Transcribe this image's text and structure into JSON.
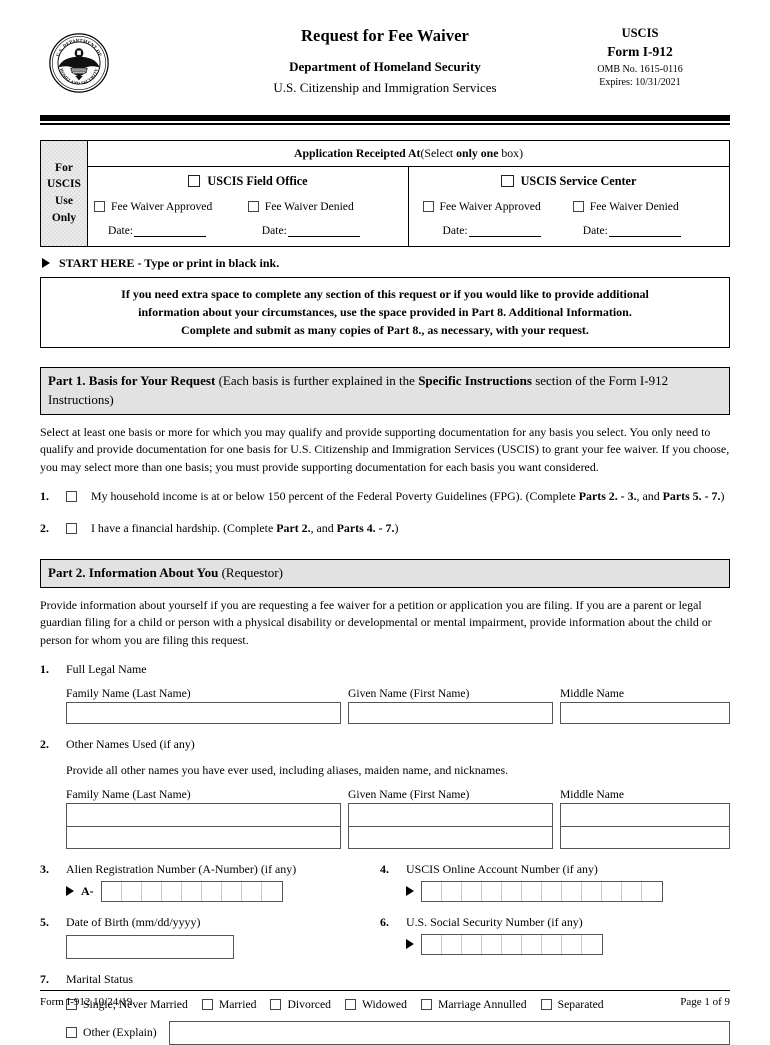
{
  "header": {
    "seal_icon": "dhs-seal-icon",
    "seal_text_top": "U.S. DEPARTMENT OF",
    "seal_text_bottom": "HOMELAND SECURITY",
    "title": "Request for Fee Waiver",
    "agency": "Department of Homeland Security",
    "subagency": "U.S. Citizenship and Immigration Services",
    "uscis": "USCIS",
    "form_number": "Form I-912",
    "omb": "OMB No. 1615-0116",
    "expires": "Expires: 10/31/2021"
  },
  "uscis_use": {
    "side_label_lines": [
      "For",
      "USCIS",
      "Use",
      "Only"
    ],
    "receipt_head_plain_1": "Application Receipted At",
    "receipt_head_paren_open": "(Select ",
    "receipt_head_bold": "only one",
    "receipt_head_paren_close": " box)",
    "columns": [
      {
        "office": "USCIS Field Office",
        "approved": "Fee Waiver Approved",
        "denied": "Fee Waiver Denied",
        "date_label_1": "Date:",
        "date_label_2": "Date:"
      },
      {
        "office": "USCIS Service Center",
        "approved": "Fee Waiver Approved",
        "denied": "Fee Waiver Denied",
        "date_label_1": "Date:",
        "date_label_2": "Date:"
      }
    ]
  },
  "start_here": {
    "arrow_icon": "right-triangle-icon",
    "text": "START HERE - Type or print in black ink."
  },
  "notice": {
    "line1": "If you need extra space to complete any section of this request or if you would like to provide additional",
    "line2": "information about your circumstances, use the space provided in Part 8. Additional Information.",
    "line3": "Complete and submit as many copies of Part 8., as necessary, with your request."
  },
  "part1": {
    "heading_bold_1": "Part 1.  Basis for Your Request",
    "heading_plain_1": " (Each basis is further explained in the ",
    "heading_bold_2": "Specific Instructions",
    "heading_plain_2": " section of the Form I-912 Instructions)",
    "intro": "Select at least one basis or more for which you may qualify and provide supporting documentation for any basis you select.  You only need to qualify and provide documentation for one basis for U.S. Citizenship and Immigration Services (USCIS) to grant your fee waiver.  If you choose, you may select more than one basis; you must provide supporting documentation for each basis you want considered.",
    "items": [
      {
        "number": "1.",
        "text_a": "My household income is at or below 150 percent of the Federal Poverty Guidelines (FPG).  (Complete ",
        "bold_a": "Parts 2. - 3.",
        "text_b": ", and ",
        "bold_b": "Parts 5. - 7.",
        "text_c": ")"
      },
      {
        "number": "2.",
        "text_a": "I have a financial hardship.  (Complete ",
        "bold_a": "Part 2.",
        "text_b": ", and ",
        "bold_b": "Parts 4. - 7.",
        "text_c": ")"
      }
    ]
  },
  "part2": {
    "heading_bold": "Part 2.  Information About You",
    "heading_plain": " (Requestor)",
    "intro": "Provide information about yourself if you are requesting a fee waiver for a petition or application you are filing.  If you are a parent or legal guardian filing for a child or person with a physical disability or developmental or mental impairment, provide information about the child or person for whom you are filing this request.",
    "q1": {
      "number": "1.",
      "label": "Full Legal Name",
      "family_label": "Family Name (Last Name)",
      "given_label": "Given Name (First Name)",
      "middle_label": "Middle Name",
      "family_value": "",
      "given_value": "",
      "middle_value": ""
    },
    "q2": {
      "number": "2.",
      "label": "Other Names Used (if any)",
      "note": "Provide all other names you have ever used, including aliases, maiden name, and nicknames.",
      "family_label": "Family Name (Last Name)",
      "given_label": "Given Name (First Name)",
      "middle_label": "Middle Name"
    },
    "q3": {
      "number": "3.",
      "label": "Alien Registration Number (A-Number) (if any)",
      "prefix": "A-",
      "cells": 9,
      "arrow_icon": "right-triangle-icon"
    },
    "q4": {
      "number": "4.",
      "label": "USCIS Online Account Number (if any)",
      "cells": 12,
      "arrow_icon": "right-triangle-icon"
    },
    "q5": {
      "number": "5.",
      "label": "Date of Birth (mm/dd/yyyy)",
      "value": ""
    },
    "q6": {
      "number": "6.",
      "label": "U.S. Social Security Number (if any)",
      "cells": 9,
      "arrow_icon": "right-triangle-icon"
    },
    "q7": {
      "number": "7.",
      "label": "Marital Status",
      "options": [
        "Single, Never Married",
        "Married",
        "Divorced",
        "Widowed",
        "Marriage Annulled",
        "Separated"
      ],
      "other_label": "Other (Explain)",
      "other_value": ""
    }
  },
  "footer": {
    "left": "Form I-912   10/24/19",
    "right": "Page 1 of 9"
  }
}
